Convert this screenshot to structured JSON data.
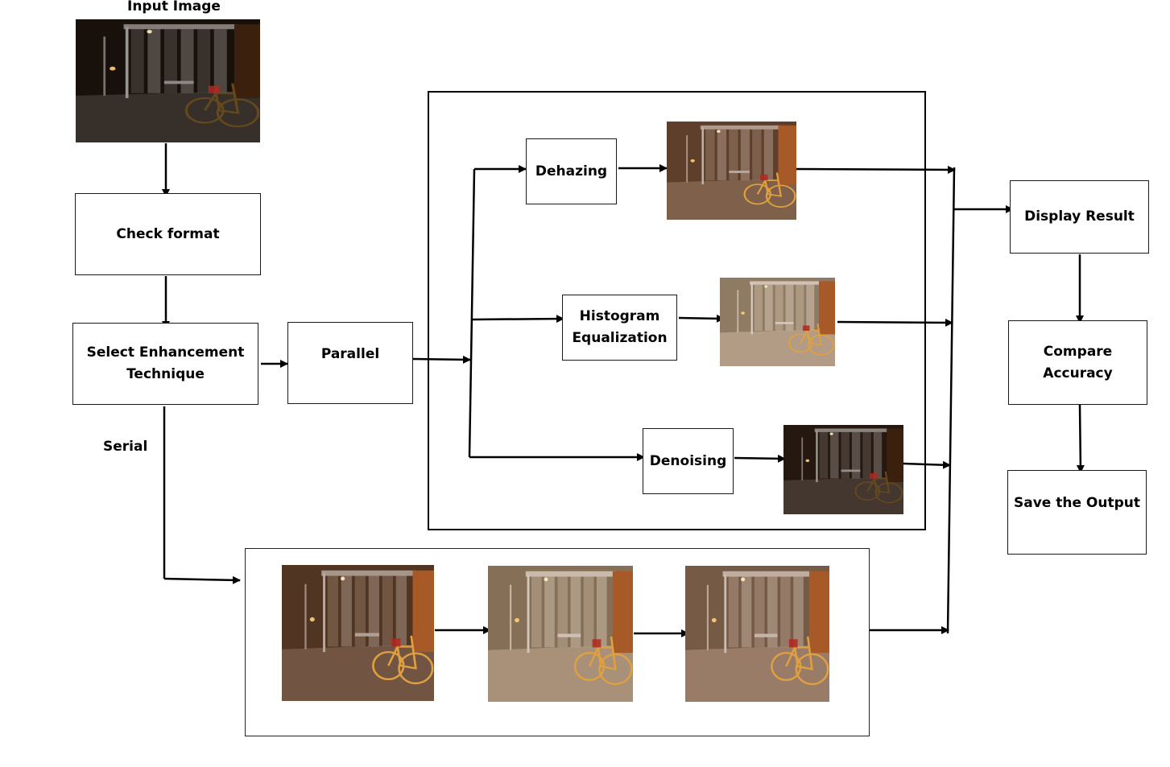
{
  "input": {
    "label": "Input Image"
  },
  "steps": {
    "check_format": "Check format",
    "select_technique_line1": "Select Enhancement",
    "select_technique_line2": "Technique",
    "parallel": "Parallel",
    "serial": "Serial",
    "dehazing": "Dehazing",
    "histogram_line1": "Histogram",
    "histogram_line2": "Equalization",
    "denoising": "Denoising",
    "display_result": "Display Result",
    "compare_line1": "Compare",
    "compare_line2": "Accuracy",
    "save_output": "Save the Output"
  },
  "photo_tones": {
    "original": "#1c130c",
    "dehazed": "#6e4a32",
    "histogram": "#a88f74",
    "denoised": "#2a1c13",
    "serial_1": "#5e3e28",
    "serial_2": "#9c8266",
    "serial_3": "#8a6a52"
  }
}
